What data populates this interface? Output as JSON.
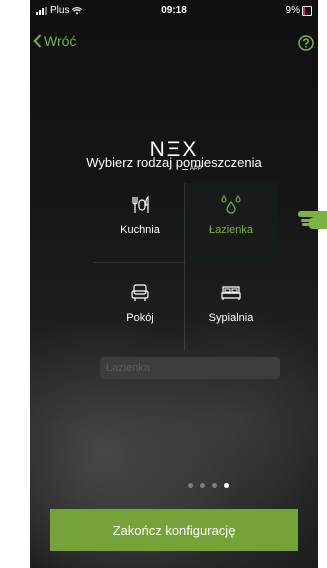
{
  "status_bar": {
    "carrier": "Plus",
    "time": "09:18",
    "battery": "9%"
  },
  "nav": {
    "back_label": "Wróć"
  },
  "logo": {
    "word": "NΞX",
    "sub": "APP"
  },
  "title": "Wybierz rodzaj pomieszczenia",
  "rooms": [
    {
      "label": "Kuchnia",
      "icon": "utensils-icon",
      "selected": false
    },
    {
      "label": "Łazienka",
      "icon": "water-drops-icon",
      "selected": true
    },
    {
      "label": "Pokój",
      "icon": "armchair-icon",
      "selected": false
    },
    {
      "label": "Sypialnia",
      "icon": "bed-icon",
      "selected": false
    }
  ],
  "room_name_input": {
    "placeholder": "Łazienka",
    "value": ""
  },
  "pager": {
    "count": 4,
    "active_index": 3
  },
  "finish_button": {
    "label": "Zakończ konfigurację"
  },
  "colors": {
    "accent": "#7cb342",
    "button": "#76a23a"
  }
}
